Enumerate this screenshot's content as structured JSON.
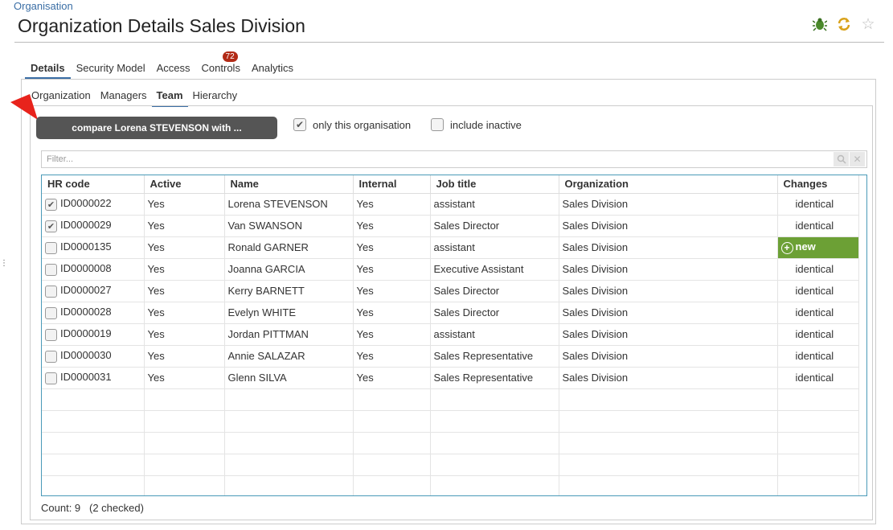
{
  "breadcrumb": "Organisation",
  "page_title": "Organization Details Sales Division",
  "header_icons": [
    "bug-icon",
    "sync-icon",
    "star-icon"
  ],
  "tabs": [
    {
      "label": "Details",
      "active": true
    },
    {
      "label": "Security Model"
    },
    {
      "label": "Access"
    },
    {
      "label": "Controls",
      "badge": "72"
    },
    {
      "label": "Analytics"
    }
  ],
  "subtabs": [
    {
      "label": "Organization"
    },
    {
      "label": "Managers"
    },
    {
      "label": "Team",
      "active": true
    },
    {
      "label": "Hierarchy"
    }
  ],
  "compare_button": "compare Lorena STEVENSON with ...",
  "options": {
    "only_this_org": {
      "label": "only this organisation",
      "checked": true
    },
    "include_inactive": {
      "label": "include inactive",
      "checked": false
    }
  },
  "filter": {
    "placeholder": "Filter..."
  },
  "table": {
    "columns": [
      "HR code",
      "Active",
      "Name",
      "Internal",
      "Job title",
      "Organization",
      "Changes"
    ],
    "rows": [
      {
        "checked": true,
        "hr": "ID0000022",
        "active": "Yes",
        "name": "Lorena STEVENSON",
        "internal": "Yes",
        "job": "assistant",
        "org": "Sales Division",
        "changes": "identical"
      },
      {
        "checked": true,
        "hr": "ID0000029",
        "active": "Yes",
        "name": "Van SWANSON",
        "internal": "Yes",
        "job": "Sales Director",
        "org": "Sales Division",
        "changes": "identical"
      },
      {
        "checked": false,
        "hr": "ID0000135",
        "active": "Yes",
        "name": "Ronald GARNER",
        "internal": "Yes",
        "job": "assistant",
        "org": "Sales Division",
        "changes": "new"
      },
      {
        "checked": false,
        "hr": "ID0000008",
        "active": "Yes",
        "name": "Joanna GARCIA",
        "internal": "Yes",
        "job": "Executive Assistant",
        "org": "Sales Division",
        "changes": "identical"
      },
      {
        "checked": false,
        "hr": "ID0000027",
        "active": "Yes",
        "name": "Kerry BARNETT",
        "internal": "Yes",
        "job": "Sales Director",
        "org": "Sales Division",
        "changes": "identical"
      },
      {
        "checked": false,
        "hr": "ID0000028",
        "active": "Yes",
        "name": "Evelyn WHITE",
        "internal": "Yes",
        "job": "Sales Director",
        "org": "Sales Division",
        "changes": "identical"
      },
      {
        "checked": false,
        "hr": "ID0000019",
        "active": "Yes",
        "name": "Jordan PITTMAN",
        "internal": "Yes",
        "job": "assistant",
        "org": "Sales Division",
        "changes": "identical"
      },
      {
        "checked": false,
        "hr": "ID0000030",
        "active": "Yes",
        "name": "Annie SALAZAR",
        "internal": "Yes",
        "job": "Sales Representative",
        "org": "Sales Division",
        "changes": "identical"
      },
      {
        "checked": false,
        "hr": "ID0000031",
        "active": "Yes",
        "name": "Glenn SILVA",
        "internal": "Yes",
        "job": "Sales Representative",
        "org": "Sales Division",
        "changes": "identical"
      }
    ]
  },
  "count": "Count: 9",
  "checked_info": "(2 checked)",
  "colors": {
    "accent": "#3a6ea5",
    "new_badge": "#6ca035",
    "button": "#555555",
    "badge": "#b22a16",
    "arrow": "#e8231c"
  }
}
